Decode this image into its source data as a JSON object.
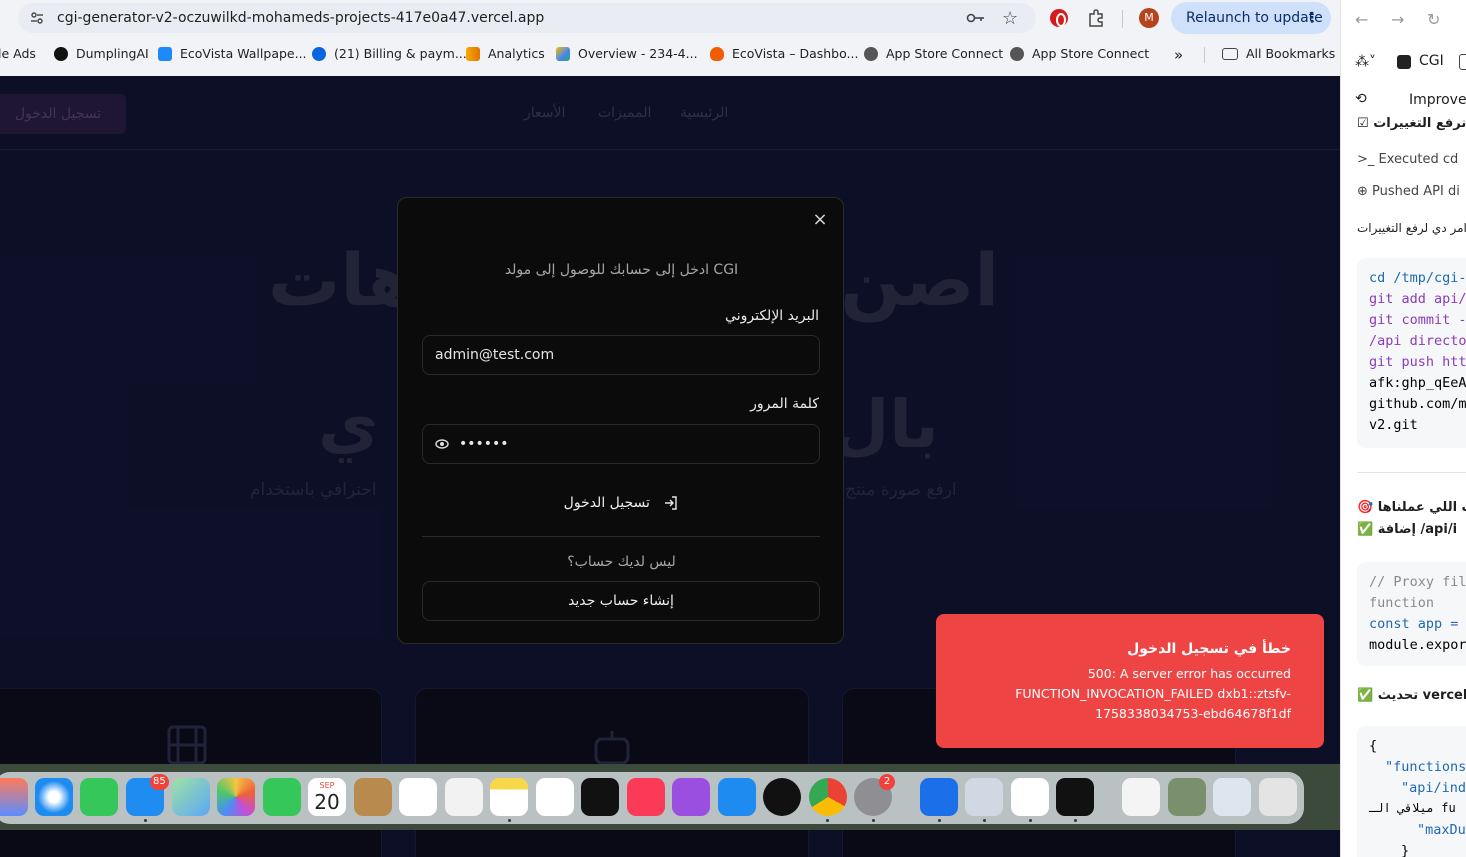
{
  "browser": {
    "url": "cgi-generator-v2-oczuwilkd-mohameds-projects-417e0a47.vercel.app",
    "profile_initial": "M",
    "relaunch_label": "Relaunch to update",
    "bookmarks": [
      "le Ads",
      "DumplingAI",
      "EcoVista Wallpape...",
      "(21) Billing & paym...",
      "Analytics",
      "Overview - 234-4...",
      "EcoVista – Dashbo...",
      "App Store Connect",
      "App Store Connect"
    ],
    "bookmarks_more": "»",
    "all_bookmarks": "All Bookmarks"
  },
  "site_nav": {
    "links": [
      "الرئيسية",
      "المميزات",
      "الأسعار"
    ],
    "login_button": "تسجيل الدخول"
  },
  "hero": {
    "line1_right": "اصن",
    "line1_left": "هات",
    "line2_right": "بال",
    "line2_left": "ي",
    "sub_right": "ارفع صورة منتج",
    "sub_left": "احترافي باستخدام"
  },
  "modal": {
    "subtitle": "ادخل إلى حسابك للوصول إلى مولد CGI",
    "email_label": "البريد الإلكتروني",
    "email_value": "admin@test.com",
    "password_label": "كلمة المرور",
    "password_value": "••••••",
    "submit_label": "تسجيل الدخول",
    "no_account": "ليس لديك حساب؟",
    "register_label": "إنشاء حساب جديد",
    "close_icon": "×"
  },
  "toast": {
    "title": "خطأ في تسجيل الدخول",
    "body": "500: A server error has occurred FUNCTION_INVOCATION_FAILED dxb1::ztsfv-1758338034753-ebd64678f1df"
  },
  "dock": {
    "mail_badge": "85",
    "settings_badge": "2",
    "calendar_month": "SEP",
    "calendar_day": "20"
  },
  "side_panel": {
    "tab_label": "CGI",
    "improve_label": "Improve",
    "heading_partial": "ي نرفع التغييرات",
    "executed_label": "Executed cd",
    "pushed_label": "Pushed API di",
    "commands_note": "وامر دي لرفع التغييرات",
    "code1": [
      "cd /tmp/cgi-",
      "git add api/",
      "git commit -",
      "/api directo",
      "git push htt",
      "afk:ghp_qEeA",
      "github.com/m",
      "v2.git"
    ],
    "done_heading": "ات اللي عملناها",
    "add_label": "إضافة /api/i",
    "code2": [
      "// Proxy fil",
      "function",
      "const app =",
      "module.expor"
    ],
    "update_label": "تحديث vercel",
    "code3": [
      "{",
      "\"functions",
      "\"api/ind",
      "ميلاقي الـ fu",
      "\"maxDu",
      "}"
    ]
  }
}
